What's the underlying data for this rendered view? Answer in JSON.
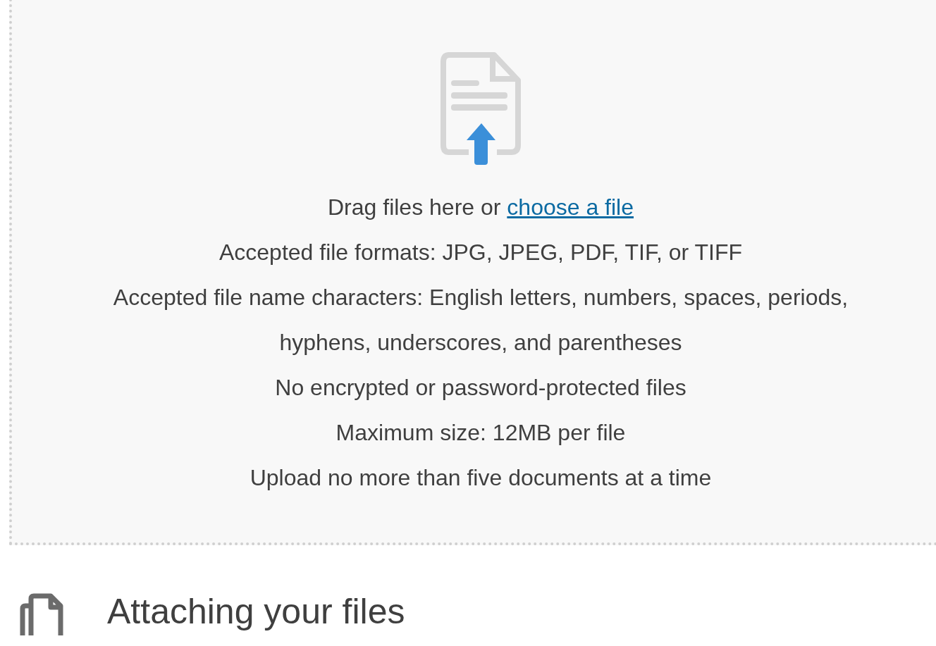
{
  "dropzone": {
    "prompt": "Drag files here or ",
    "link": "choose a file",
    "rules": [
      "Accepted file formats: JPG, JPEG, PDF, TIF, or TIFF",
      "Accepted file name characters: English letters, numbers, spaces, periods, hyphens, underscores, and parentheses",
      "No encrypted or password-protected files",
      "Maximum size: 12MB per file",
      "Upload no more than five documents at a time"
    ]
  },
  "section": {
    "heading": "Attaching your files"
  }
}
